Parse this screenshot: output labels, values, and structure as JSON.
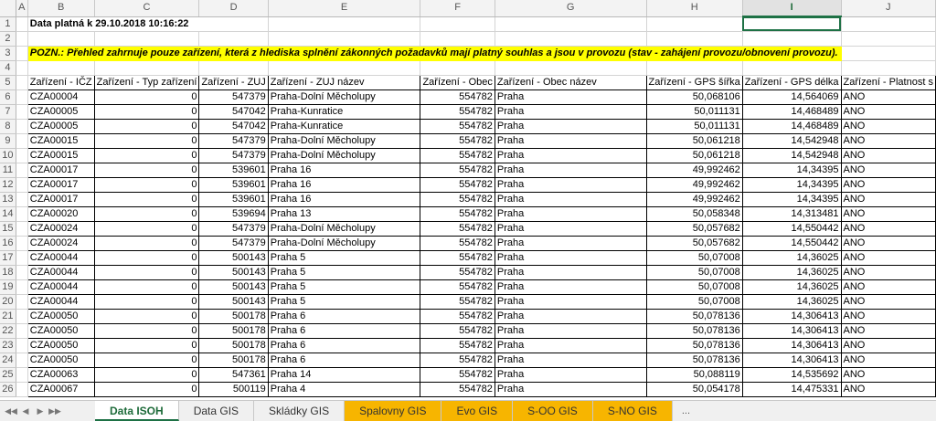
{
  "columns": [
    "A",
    "B",
    "C",
    "D",
    "E",
    "F",
    "G",
    "H",
    "I",
    "J"
  ],
  "active_column": "I",
  "header_info": "Data platná k 29.10.2018  10:16:22",
  "notice": "POZN.: Přehled zahrnuje pouze zařízení, která  z hlediska splnění zákonných požadavků mají platný souhlas a jsou v provozu (stav - zahájení provozu/obnovení provozu).",
  "table_headers": [
    "Zařízení - IČZ",
    "Zařízení - Typ zařízení",
    "Zařízení - ZUJ",
    "Zařízení - ZUJ název",
    "Zařízení - Obec",
    "Zařízení - Obec název",
    "Zařízení - GPS šířka",
    "Zařízení - GPS délka",
    "Zařízení - Platnost s"
  ],
  "rows": [
    {
      "n": "6",
      "c": [
        "CZA00004",
        "0",
        "547379",
        "Praha-Dolní Měcholupy",
        "554782",
        "Praha",
        "50,068106",
        "14,564069",
        "ANO"
      ]
    },
    {
      "n": "7",
      "c": [
        "CZA00005",
        "0",
        "547042",
        "Praha-Kunratice",
        "554782",
        "Praha",
        "50,011131",
        "14,468489",
        "ANO"
      ]
    },
    {
      "n": "8",
      "c": [
        "CZA00005",
        "0",
        "547042",
        "Praha-Kunratice",
        "554782",
        "Praha",
        "50,011131",
        "14,468489",
        "ANO"
      ]
    },
    {
      "n": "9",
      "c": [
        "CZA00015",
        "0",
        "547379",
        "Praha-Dolní Měcholupy",
        "554782",
        "Praha",
        "50,061218",
        "14,542948",
        "ANO"
      ]
    },
    {
      "n": "10",
      "c": [
        "CZA00015",
        "0",
        "547379",
        "Praha-Dolní Měcholupy",
        "554782",
        "Praha",
        "50,061218",
        "14,542948",
        "ANO"
      ]
    },
    {
      "n": "11",
      "c": [
        "CZA00017",
        "0",
        "539601",
        "Praha 16",
        "554782",
        "Praha",
        "49,992462",
        "14,34395",
        "ANO"
      ]
    },
    {
      "n": "12",
      "c": [
        "CZA00017",
        "0",
        "539601",
        "Praha 16",
        "554782",
        "Praha",
        "49,992462",
        "14,34395",
        "ANO"
      ]
    },
    {
      "n": "13",
      "c": [
        "CZA00017",
        "0",
        "539601",
        "Praha 16",
        "554782",
        "Praha",
        "49,992462",
        "14,34395",
        "ANO"
      ]
    },
    {
      "n": "14",
      "c": [
        "CZA00020",
        "0",
        "539694",
        "Praha 13",
        "554782",
        "Praha",
        "50,058348",
        "14,313481",
        "ANO"
      ]
    },
    {
      "n": "15",
      "c": [
        "CZA00024",
        "0",
        "547379",
        "Praha-Dolní Měcholupy",
        "554782",
        "Praha",
        "50,057682",
        "14,550442",
        "ANO"
      ]
    },
    {
      "n": "16",
      "c": [
        "CZA00024",
        "0",
        "547379",
        "Praha-Dolní Měcholupy",
        "554782",
        "Praha",
        "50,057682",
        "14,550442",
        "ANO"
      ]
    },
    {
      "n": "17",
      "c": [
        "CZA00044",
        "0",
        "500143",
        "Praha 5",
        "554782",
        "Praha",
        "50,07008",
        "14,36025",
        "ANO"
      ]
    },
    {
      "n": "18",
      "c": [
        "CZA00044",
        "0",
        "500143",
        "Praha 5",
        "554782",
        "Praha",
        "50,07008",
        "14,36025",
        "ANO"
      ]
    },
    {
      "n": "19",
      "c": [
        "CZA00044",
        "0",
        "500143",
        "Praha 5",
        "554782",
        "Praha",
        "50,07008",
        "14,36025",
        "ANO"
      ]
    },
    {
      "n": "20",
      "c": [
        "CZA00044",
        "0",
        "500143",
        "Praha 5",
        "554782",
        "Praha",
        "50,07008",
        "14,36025",
        "ANO"
      ]
    },
    {
      "n": "21",
      "c": [
        "CZA00050",
        "0",
        "500178",
        "Praha 6",
        "554782",
        "Praha",
        "50,078136",
        "14,306413",
        "ANO"
      ]
    },
    {
      "n": "22",
      "c": [
        "CZA00050",
        "0",
        "500178",
        "Praha 6",
        "554782",
        "Praha",
        "50,078136",
        "14,306413",
        "ANO"
      ]
    },
    {
      "n": "23",
      "c": [
        "CZA00050",
        "0",
        "500178",
        "Praha 6",
        "554782",
        "Praha",
        "50,078136",
        "14,306413",
        "ANO"
      ]
    },
    {
      "n": "24",
      "c": [
        "CZA00050",
        "0",
        "500178",
        "Praha 6",
        "554782",
        "Praha",
        "50,078136",
        "14,306413",
        "ANO"
      ]
    },
    {
      "n": "25",
      "c": [
        "CZA00063",
        "0",
        "547361",
        "Praha 14",
        "554782",
        "Praha",
        "50,088119",
        "14,535692",
        "ANO"
      ]
    },
    {
      "n": "26",
      "c": [
        "CZA00067",
        "0",
        "500119",
        "Praha 4",
        "554782",
        "Praha",
        "50,054178",
        "14,475331",
        "ANO"
      ]
    }
  ],
  "tabs": [
    {
      "label": "Data ISOH",
      "style": "active"
    },
    {
      "label": "Data GIS",
      "style": "normal"
    },
    {
      "label": "Skládky GIS",
      "style": "normal"
    },
    {
      "label": "Spalovny GIS",
      "style": "orange"
    },
    {
      "label": "Evo GIS",
      "style": "orange"
    },
    {
      "label": "S-OO GIS",
      "style": "orange"
    },
    {
      "label": "S-NO GIS",
      "style": "orange"
    }
  ],
  "more_tabs": "...",
  "nav": {
    "first": "◀◀",
    "prev": "◀",
    "next": "▶",
    "last": "▶▶"
  }
}
